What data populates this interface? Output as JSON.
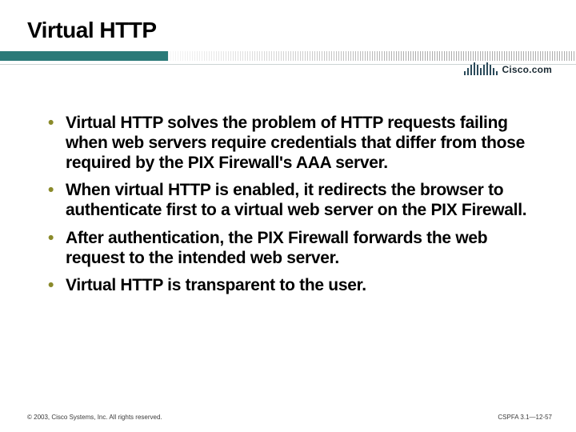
{
  "title": "Virtual HTTP",
  "logo_text": "Cisco.com",
  "bullets": [
    "Virtual HTTP solves the problem of HTTP requests failing when web servers require credentials that differ from those required by the PIX Firewall's AAA server.",
    "When virtual HTTP is enabled, it redirects the browser to authenticate first to a virtual web server on the PIX Firewall.",
    "After authentication, the PIX Firewall forwards the web request to the intended web server.",
    "Virtual HTTP is transparent to the user."
  ],
  "footer": {
    "left": "© 2003, Cisco Systems, Inc. All rights reserved.",
    "right": "CSPFA 3.1—12-57"
  }
}
